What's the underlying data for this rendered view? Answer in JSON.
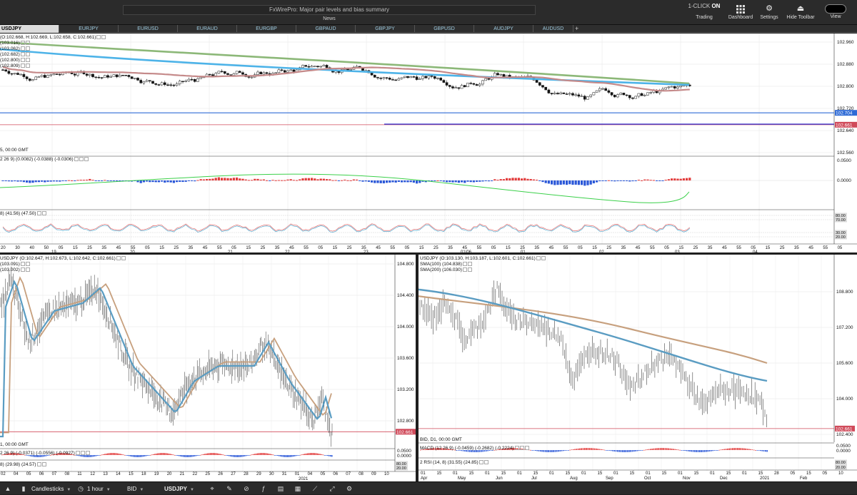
{
  "topbar": {
    "news_text": "FxWirePro: Major pair levels and bias summary",
    "news_label": "News",
    "one_click_prefix": "1-CLICK",
    "one_click_state": "ON",
    "trading_label": "Trading",
    "dashboard_label": "Dashboard",
    "settings_label": "Settings",
    "hide_toolbar_label": "Hide Toolbar",
    "view_label": "View"
  },
  "tabs": [
    "USDJPY",
    "EURJPY",
    "EURUSD",
    "EURAUD",
    "EURGBP",
    "GBPAUD",
    "GBPJPY",
    "GBPUSD",
    "AUDJPY",
    "AUDUSD"
  ],
  "active_tab": "USDJPY",
  "pane1": {
    "ohlc": "(O:102.668, H:102.669, L:102.658, C:102.661)",
    "legend": [
      "(103.016)",
      "(103.062)",
      "(102.682)",
      "(102.800)",
      "(102.809)"
    ],
    "time_note": "5, 00:00 GMT",
    "macd": "2 26 9) (0.0082) (-0.0388) (-0.0306)",
    "rsi": "8) (41.56) (47.50)",
    "price_ticks": [
      "102.960",
      "102.880",
      "102.800",
      "102.720",
      "102.640",
      "102.560"
    ],
    "price_highlights": [
      "102.704",
      "102.661"
    ],
    "macd_ticks": [
      "0.0500",
      "0.0000"
    ],
    "rsi_ticks": [
      "80.00",
      "70.00",
      "30.00",
      "20.00"
    ],
    "time_ticks": [
      "20",
      "30",
      "40",
      "50",
      "05",
      "15",
      "25",
      "35",
      "45",
      "55",
      "05",
      "15",
      "25",
      "35",
      "45",
      "55",
      "05",
      "15",
      "25",
      "35",
      "45",
      "55",
      "05",
      "15",
      "25",
      "35",
      "45",
      "55",
      "05",
      "15",
      "25",
      "35",
      "45",
      "55",
      "05",
      "15",
      "25",
      "35",
      "45",
      "55",
      "05",
      "15",
      "25",
      "35",
      "45",
      "55",
      "05",
      "15",
      "25",
      "35",
      "45",
      "55",
      "05",
      "15",
      "25",
      "35",
      "45",
      "55",
      "05",
      "15",
      "25",
      "35",
      "45",
      "55",
      "05",
      "15",
      "25",
      "35",
      "45",
      "55",
      "05",
      "15",
      "25",
      "35",
      "45",
      "55",
      "05",
      "15",
      "25",
      "35",
      "45",
      "55",
      "05",
      "15",
      "25",
      "35",
      "45",
      "55",
      "05",
      "15",
      "25",
      "35",
      "45",
      "55",
      "05",
      "15",
      "25",
      "35",
      "45",
      "55",
      "05"
    ],
    "day_ticks": [
      "19",
      "20",
      "21",
      "22",
      "23",
      "01/06",
      "01",
      "02",
      "03",
      "04"
    ]
  },
  "pane2": {
    "ohlc": "USDJPY (O:102.647, H:102.673, L:102.642, C:102.661)",
    "legend": [
      "(103.091)",
      "(103.002)"
    ],
    "time_note": "1, 00:00 GMT",
    "macd": "2 26 9) (-0.0371) (-0.0556) (-0.0927)",
    "rsi": "8) (29.98) (24.57)",
    "price_ticks": [
      "104.800",
      "104.400",
      "104.000",
      "103.600",
      "103.200",
      "102.800"
    ],
    "price_highlight": "102.661",
    "macd_ticks": [
      "0.0500",
      "0.0000"
    ],
    "rsi_ticks": [
      "80.00",
      "20.00"
    ],
    "date_ticks": [
      "02",
      "04",
      "05",
      "06",
      "07",
      "08",
      "11",
      "12",
      "13",
      "14",
      "15",
      "18",
      "19",
      "20",
      "21",
      "22",
      "25",
      "26",
      "27",
      "28",
      "29",
      "30",
      "31",
      "01",
      "04",
      "05",
      "06",
      "07",
      "08",
      "09",
      "10"
    ],
    "year_label": "2021"
  },
  "pane3": {
    "ohlc": "USDJPY (O:103.130, H:103.187, L:102.601, C:102.661)",
    "legend": [
      "SMA(100) (104.838)",
      "SMA(200) (106.030)"
    ],
    "time_note": "BID, D1, 00:00 GMT",
    "macd": "MACD (12 26 9) (-0.0459) (-0.2682) (-0.2224)",
    "rsi": "2 RSI (14, 8) (31.55) (24.85)",
    "price_ticks": [
      "108.800",
      "107.200",
      "105.600",
      "104.000",
      "102.400"
    ],
    "price_highlight": "102.661",
    "macd_ticks": [
      "0.0500",
      "0.0000"
    ],
    "rsi_ticks": [
      "80.00",
      "20.00"
    ],
    "date_ticks": [
      "01",
      "15",
      "01",
      "15",
      "01",
      "15",
      "01",
      "15",
      "01",
      "15",
      "01",
      "15",
      "01",
      "15",
      "01",
      "15",
      "01",
      "15",
      "01",
      "15",
      "01",
      "15",
      "28",
      "05",
      "15",
      "05",
      "10"
    ],
    "month_ticks": [
      "Apr",
      "May",
      "Jun",
      "Jul",
      "Aug",
      "Sep",
      "Oct",
      "Nov",
      "Dec",
      "2021",
      "Feb"
    ]
  },
  "bottombar": {
    "chart_type": "Candlesticks",
    "timeframe": "1 hour",
    "price_type": "BID",
    "symbol": "USDJPY"
  },
  "colors": {
    "accent_blue": "#2f6bd6",
    "ma_blue": "#4db3e8",
    "ma_green": "#8cb878",
    "ma_red": "#c58a8a",
    "sma100": "#5a9cc2",
    "sma200": "#c7a07e"
  }
}
